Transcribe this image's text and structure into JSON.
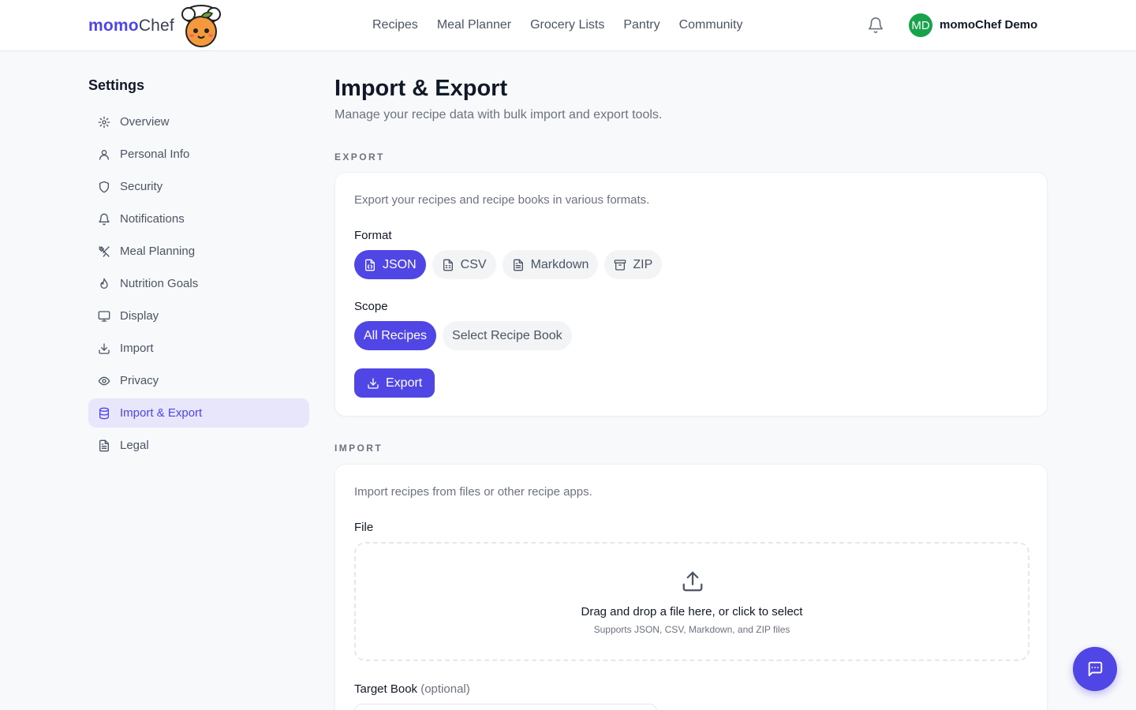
{
  "header": {
    "brand_primary": "momo",
    "brand_secondary": "Chef",
    "nav": [
      "Recipes",
      "Meal Planner",
      "Grocery Lists",
      "Pantry",
      "Community"
    ],
    "avatar_initials": "MD",
    "user_name": "momoChef Demo"
  },
  "sidebar": {
    "title": "Settings",
    "items": [
      {
        "label": "Overview",
        "icon": "gear-icon"
      },
      {
        "label": "Personal Info",
        "icon": "user-icon"
      },
      {
        "label": "Security",
        "icon": "shield-icon"
      },
      {
        "label": "Notifications",
        "icon": "bell-icon"
      },
      {
        "label": "Meal Planning",
        "icon": "utensils-icon"
      },
      {
        "label": "Nutrition Goals",
        "icon": "flame-icon"
      },
      {
        "label": "Display",
        "icon": "monitor-icon"
      },
      {
        "label": "Import",
        "icon": "download-icon"
      },
      {
        "label": "Privacy",
        "icon": "eye-icon"
      },
      {
        "label": "Import & Export",
        "icon": "database-icon",
        "active": true
      },
      {
        "label": "Legal",
        "icon": "document-icon"
      }
    ]
  },
  "main": {
    "title": "Import & Export",
    "subtitle": "Manage your recipe data with bulk import and export tools.",
    "export": {
      "section_label": "EXPORT",
      "description": "Export your recipes and recipe books in various formats.",
      "format_label": "Format",
      "formats": [
        "JSON",
        "CSV",
        "Markdown",
        "ZIP"
      ],
      "selected_format": "JSON",
      "scope_label": "Scope",
      "scopes": [
        "All Recipes",
        "Select Recipe Book"
      ],
      "selected_scope": "All Recipes",
      "export_button": "Export"
    },
    "import": {
      "section_label": "IMPORT",
      "description": "Import recipes from files or other recipe apps.",
      "file_label": "File",
      "dropzone_title": "Drag and drop a file here, or click to select",
      "dropzone_hint": "Supports JSON, CSV, Markdown, and ZIP files",
      "target_label": "Target Book",
      "target_optional": "(optional)"
    }
  },
  "colors": {
    "accent": "#4f46e5",
    "avatar": "#16a34a",
    "active_bg": "#e8e6fb"
  }
}
